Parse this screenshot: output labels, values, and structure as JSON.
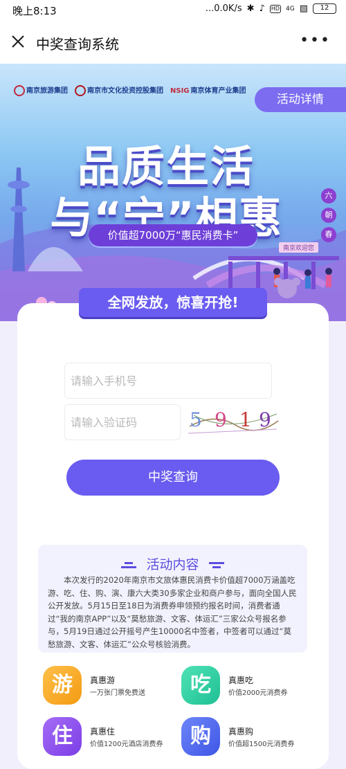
{
  "status_bar": {
    "time": "晚上8:13",
    "network_speed": "...0.0K/s",
    "signal": "4G",
    "battery": "12"
  },
  "nav": {
    "title": "中奖查询系统"
  },
  "banner": {
    "sponsors": [
      "南京旅游集团",
      "南京市文化投资控股集团",
      "南京体育产业集团"
    ],
    "detail_button": "活动详情",
    "headline_1": "品质生活",
    "headline_2": "与“宁”相惠",
    "ribbon": "价值超7000万“惠民消费卡”",
    "side_seal": [
      "六",
      "朝",
      "春"
    ],
    "scene_sign": "南京欢迎您"
  },
  "form": {
    "slogan": "全网发放，惊喜开抢!",
    "phone_placeholder": "请输入手机号",
    "code_placeholder": "请输入验证码",
    "captcha": [
      "5",
      "9",
      "1",
      "9"
    ],
    "submit": "中奖查询"
  },
  "activity": {
    "title": "活动内容",
    "text": "本次发行的2020年南京市文旅体惠民消费卡价值超7000万涵盖吃游、吃、住、购、演、康六大类30多家企业和商户参与，面向全国人民公开发放。5月15日至18日为消费券申领预约报名时间，消费者通过“我的南京APP”以及“莫愁旅游、文客、体运汇”三家公众号报名参与，5月19日通过公开摇号产生10000名中签者，中签者可以通过“莫愁旅游、文客、体运汇”公众号核验消费。"
  },
  "categories": [
    {
      "char": "游",
      "title": "真惠游",
      "desc": "一万张门票免费送"
    },
    {
      "char": "吃",
      "title": "真惠吃",
      "desc": "价值2000元消费券"
    },
    {
      "char": "住",
      "title": "真惠住",
      "desc": "价值1200元酒店消费券"
    },
    {
      "char": "购",
      "title": "真惠购",
      "desc": "价值超1500元消费券"
    }
  ],
  "colors": {
    "accent_purple": "#6a5cf0",
    "you_orange": "#f7a21d",
    "chi_green": "#25cfa0",
    "zhu_purple": "#8a4cf0",
    "gou_blue": "#4a62f0"
  }
}
